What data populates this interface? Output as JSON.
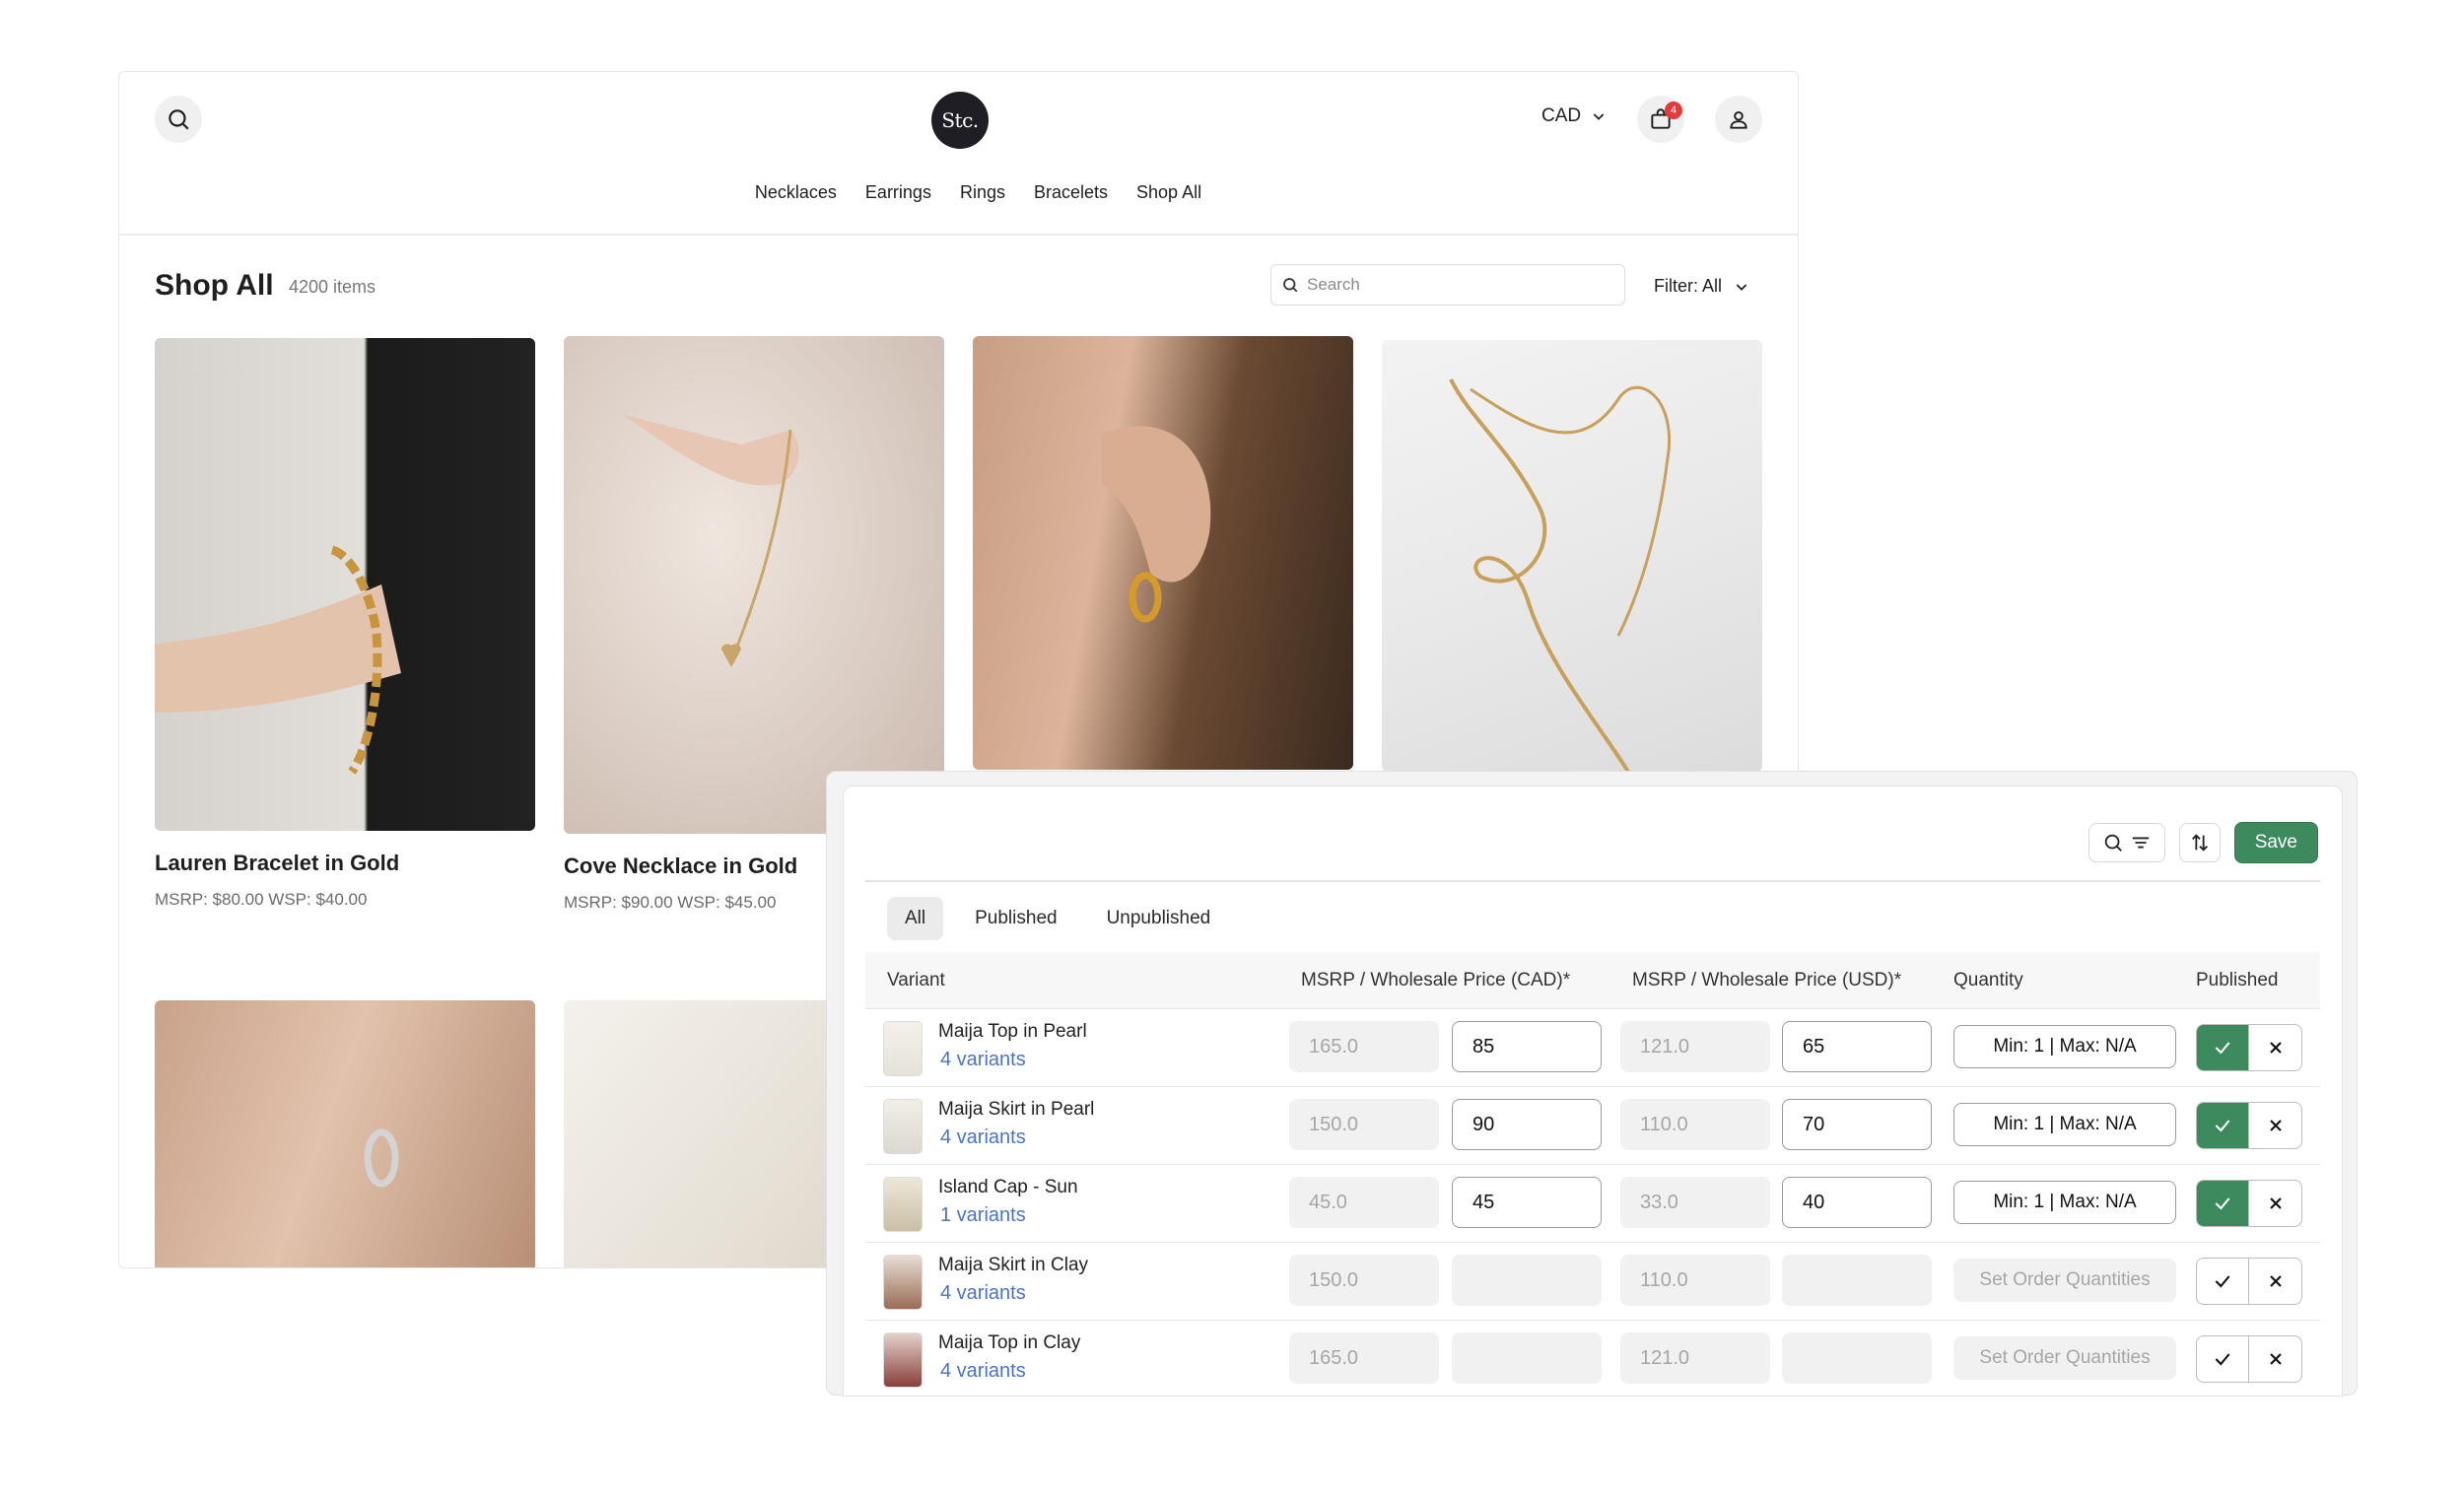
{
  "store": {
    "logo_text": "Stc.",
    "currency": "CAD",
    "cart_count": "4",
    "nav": [
      "Necklaces",
      "Earrings",
      "Rings",
      "Bracelets",
      "Shop All"
    ],
    "title": "Shop All",
    "item_count": "4200 items",
    "search_placeholder": "Search",
    "filter_label": "Filter: All",
    "products": [
      {
        "name": "Lauren Bracelet in Gold",
        "price": "MSRP: $80.00  WSP: $40.00"
      },
      {
        "name": "Cove Necklace in Gold",
        "price": "MSRP: $90.00  WSP: $45.00"
      }
    ]
  },
  "panel": {
    "save_label": "Save",
    "tabs": [
      "All",
      "Published",
      "Unpublished"
    ],
    "headers": {
      "variant": "Variant",
      "cad": "MSRP / Wholesale Price (CAD)*",
      "usd": "MSRP / Wholesale Price (USD)*",
      "quantity": "Quantity",
      "published": "Published"
    },
    "rows": [
      {
        "name": "Maija Top in Pearl",
        "variants": "4 variants",
        "msrp_cad": "165.0",
        "wsp_cad": "85",
        "msrp_usd": "121.0",
        "wsp_usd": "65",
        "quantity": "Min: 1 | Max: N/A",
        "published": true
      },
      {
        "name": "Maija Skirt in Pearl",
        "variants": "4 variants",
        "msrp_cad": "150.0",
        "wsp_cad": "90",
        "msrp_usd": "110.0",
        "wsp_usd": "70",
        "quantity": "Min: 1 | Max: N/A",
        "published": true
      },
      {
        "name": "Island Cap - Sun",
        "variants": "1 variants",
        "msrp_cad": "45.0",
        "wsp_cad": "45",
        "msrp_usd": "33.0",
        "wsp_usd": "40",
        "quantity": "Min: 1 | Max: N/A",
        "published": true
      },
      {
        "name": "Maija Skirt in Clay",
        "variants": "4 variants",
        "msrp_cad": "150.0",
        "wsp_cad": "",
        "msrp_usd": "110.0",
        "wsp_usd": "",
        "quantity": "Set Order Quantities",
        "published": false
      },
      {
        "name": "Maija Top in Clay",
        "variants": "4 variants",
        "msrp_cad": "165.0",
        "wsp_cad": "",
        "msrp_usd": "121.0",
        "wsp_usd": "",
        "quantity": "Set Order Quantities",
        "published": false
      }
    ]
  },
  "colors": {
    "accent_green": "#3d8a5e",
    "link_blue": "#4a73c9",
    "badge_red": "#e33b3b"
  }
}
